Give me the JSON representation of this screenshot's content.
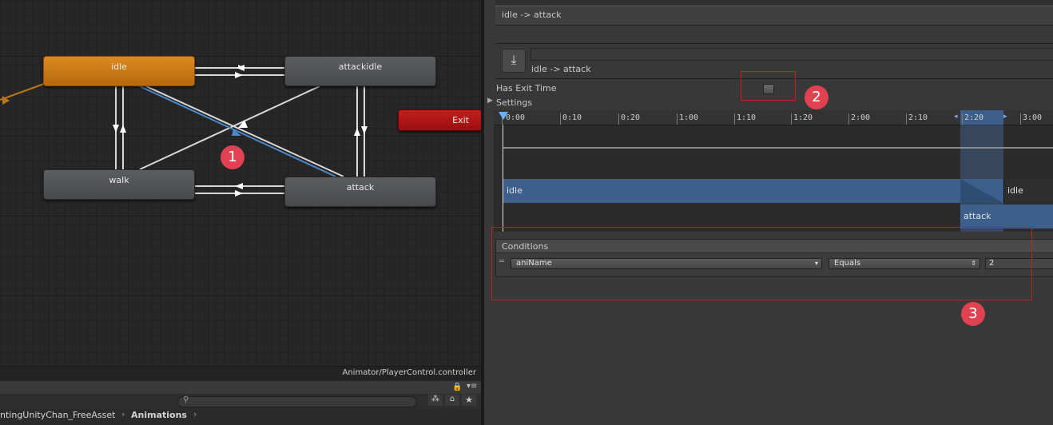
{
  "graph": {
    "states": [
      {
        "name": "idle",
        "type": "default"
      },
      {
        "name": "attackidle",
        "type": "normal"
      },
      {
        "name": "walk",
        "type": "normal"
      },
      {
        "name": "attack",
        "type": "normal"
      },
      {
        "name": "Exit",
        "type": "exit"
      }
    ],
    "path_label": "Animator/PlayerControl.controller"
  },
  "project": {
    "breadcrumb": {
      "parent": "ntingUnityChan_FreeAsset",
      "current": "Animations"
    },
    "search_placeholder": ""
  },
  "inspector": {
    "transition_list_item": "idle -> attack",
    "transition_title": "idle -> attack",
    "has_exit_time": {
      "label": "Has Exit Time",
      "checked": false
    },
    "settings_label": "Settings",
    "timeline": {
      "ticks": [
        "0:00",
        "0:10",
        "0:20",
        "1:00",
        "1:10",
        "1:20",
        "2:00",
        "2:10",
        "2:20",
        "3:00"
      ],
      "source_state": "idle",
      "next_state": "idle",
      "destination_state": "attack"
    },
    "conditions": {
      "header": "Conditions",
      "rows": [
        {
          "parameter": "aniName",
          "mode": "Equals",
          "value": "2"
        }
      ]
    }
  },
  "annotations": {
    "marker1": "1",
    "marker2": "2",
    "marker3": "3"
  },
  "colors": {
    "accent": "#4a88c7",
    "default_state": "#d98a20",
    "exit_state": "#c41e1e",
    "annotation": "#e04252"
  }
}
